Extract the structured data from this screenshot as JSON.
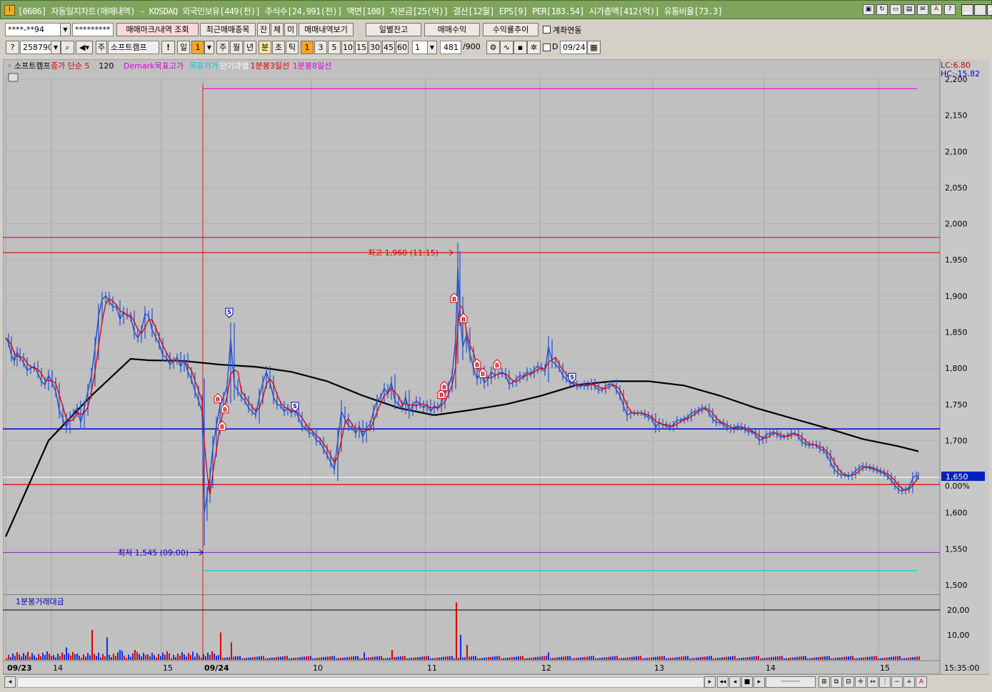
{
  "window": {
    "title": "[0606] 자동일지차트(매매내역) - KOSDAQ 외국인보유[449(천)] 주식수[24,991(천)] 액면[100] 자본금[25(억)] 결산[12월] EPS[9] PER[183.54] 시가총액[412(억)] 유통비율[73.3]",
    "app_icon": "I"
  },
  "toolbar1": {
    "account": "****-**94",
    "password": "*********",
    "btn_trade_mark": "매매마크/내역 조회",
    "btn_recent": "최근매매종목",
    "btn_jan": "잔",
    "btn_che": "체",
    "btn_mi": "미",
    "btn_trade_history": "매매내역보기",
    "btn_daily_balance": "일별잔고",
    "btn_trade_profit": "매매수익",
    "btn_return_trend": "수익률추이",
    "chk_account_link": "계좌연동"
  },
  "toolbar2": {
    "stock_code": "258790",
    "stock_type": "주",
    "stock_name": "소프트캠프",
    "excl": "!",
    "period_day": "일",
    "period_day_val": "1",
    "period_week": "주",
    "period_month": "월",
    "period_year": "년",
    "period_min": "분",
    "period_sec": "초",
    "period_tick": "틱",
    "min_options": [
      "1",
      "3",
      "5",
      "10",
      "15",
      "30",
      "45",
      "60"
    ],
    "min_value": "1",
    "count_value": "481",
    "count_total": "/900",
    "chk_d": "D",
    "date_value": "09/24"
  },
  "chart_data": {
    "type": "line",
    "legend": [
      {
        "label": "소프트캠프",
        "color": "#000000"
      },
      {
        "label": "종가 단순 5",
        "color": "#e00000"
      },
      {
        "label": "120",
        "color": "#000000"
      },
      {
        "label": "Demark목표고가",
        "color": "#e000e0"
      },
      {
        "label": "목표저가",
        "color": "#00d0d0"
      },
      {
        "label": "단기과열",
        "color": "#ffffff"
      },
      {
        "label": "1분봉3일선",
        "color": "#e00000"
      },
      {
        "label": "1분봉8일선",
        "color": "#e000e0"
      }
    ],
    "lc_label": "LC:6.80",
    "hc_label": "HC:-15.82",
    "ylim": [
      1480,
      2210
    ],
    "yticks": [
      "2,200",
      "2,150",
      "2,100",
      "2,050",
      "2,000",
      "1,950",
      "1,900",
      "1,850",
      "1,800",
      "1,750",
      "1,700",
      "1,650",
      "1,600",
      "1,550",
      "1,500"
    ],
    "x_date_labels": [
      "09/23",
      "14",
      "15",
      "09/24",
      "10",
      "11",
      "12",
      "13",
      "14",
      "15"
    ],
    "time_label": "15:35:00",
    "current_price": "1,650",
    "current_change": "0.00%",
    "high_annotation": "최고 1,960 (11:15)",
    "low_annotation": "최저 1,545 (09:00)",
    "high_value": 1960,
    "low_value": 1545,
    "hlines": [
      {
        "value": 2187,
        "color": "#e000e0",
        "name": "Demark목표고가"
      },
      {
        "value": 1981,
        "color": "#e00060",
        "name": "1분봉8일선"
      },
      {
        "value": 1960,
        "color": "#e00000",
        "name": "최고"
      },
      {
        "value": 1716,
        "color": "#0000d0",
        "name": "1분봉3일선"
      },
      {
        "value": 1649,
        "color": "#ffffff",
        "name": "단기과열"
      },
      {
        "value": 1639,
        "color": "#e00000",
        "name": "기준가"
      },
      {
        "value": 1545,
        "color": "#9030c0",
        "name": "최저"
      },
      {
        "value": 1520,
        "color": "#00d0d0",
        "name": "목표저가"
      }
    ],
    "price_series": [
      [
        0,
        1842
      ],
      [
        4,
        1835
      ],
      [
        8,
        1818
      ],
      [
        12,
        1810
      ],
      [
        16,
        1822
      ],
      [
        20,
        1815
      ],
      [
        25,
        1808
      ],
      [
        30,
        1797
      ],
      [
        35,
        1800
      ],
      [
        40,
        1803
      ],
      [
        45,
        1793
      ],
      [
        50,
        1782
      ],
      [
        55,
        1777
      ],
      [
        60,
        1790
      ],
      [
        65,
        1780
      ],
      [
        70,
        1768
      ],
      [
        75,
        1742
      ],
      [
        80,
        1730
      ],
      [
        85,
        1718
      ],
      [
        90,
        1732
      ],
      [
        95,
        1738
      ],
      [
        100,
        1745
      ],
      [
        105,
        1725
      ],
      [
        110,
        1745
      ],
      [
        115,
        1768
      ],
      [
        120,
        1790
      ],
      [
        125,
        1828
      ],
      [
        130,
        1872
      ],
      [
        135,
        1895
      ],
      [
        140,
        1900
      ],
      [
        145,
        1893
      ],
      [
        150,
        1885
      ],
      [
        155,
        1885
      ],
      [
        160,
        1868
      ],
      [
        165,
        1878
      ],
      [
        170,
        1873
      ],
      [
        175,
        1870
      ],
      [
        180,
        1850
      ],
      [
        185,
        1842
      ],
      [
        190,
        1852
      ],
      [
        195,
        1875
      ],
      [
        200,
        1873
      ],
      [
        205,
        1853
      ],
      [
        210,
        1843
      ],
      [
        215,
        1833
      ],
      [
        220,
        1818
      ],
      [
        225,
        1815
      ],
      [
        230,
        1805
      ],
      [
        235,
        1810
      ],
      [
        240,
        1815
      ],
      [
        245,
        1802
      ],
      [
        250,
        1812
      ],
      [
        255,
        1795
      ],
      [
        260,
        1785
      ],
      [
        265,
        1768
      ],
      [
        270,
        1755
      ],
      [
        275,
        1740
      ],
      [
        278,
        1600
      ],
      [
        282,
        1625
      ],
      [
        286,
        1650
      ],
      [
        290,
        1690
      ],
      [
        295,
        1720
      ],
      [
        300,
        1748
      ],
      [
        305,
        1760
      ],
      [
        310,
        1775
      ],
      [
        315,
        1840
      ],
      [
        320,
        1778
      ],
      [
        325,
        1768
      ],
      [
        330,
        1760
      ],
      [
        335,
        1755
      ],
      [
        340,
        1745
      ],
      [
        345,
        1740
      ],
      [
        350,
        1735
      ],
      [
        355,
        1760
      ],
      [
        360,
        1780
      ],
      [
        365,
        1795
      ],
      [
        370,
        1780
      ],
      [
        375,
        1760
      ],
      [
        380,
        1750
      ],
      [
        385,
        1748
      ],
      [
        390,
        1740
      ],
      [
        395,
        1745
      ],
      [
        400,
        1738
      ],
      [
        405,
        1742
      ],
      [
        410,
        1732
      ],
      [
        415,
        1720
      ],
      [
        420,
        1718
      ],
      [
        425,
        1710
      ],
      [
        430,
        1710
      ],
      [
        435,
        1700
      ],
      [
        440,
        1698
      ],
      [
        445,
        1688
      ],
      [
        450,
        1680
      ],
      [
        455,
        1670
      ],
      [
        460,
        1660
      ],
      [
        465,
        1700
      ],
      [
        470,
        1740
      ],
      [
        475,
        1730
      ],
      [
        480,
        1720
      ],
      [
        485,
        1718
      ],
      [
        490,
        1710
      ],
      [
        495,
        1720
      ],
      [
        500,
        1705
      ],
      [
        505,
        1718
      ],
      [
        510,
        1722
      ],
      [
        515,
        1740
      ],
      [
        520,
        1755
      ],
      [
        525,
        1760
      ],
      [
        530,
        1772
      ],
      [
        535,
        1765
      ],
      [
        540,
        1780
      ],
      [
        545,
        1755
      ],
      [
        550,
        1750
      ],
      [
        555,
        1745
      ],
      [
        560,
        1760
      ],
      [
        565,
        1740
      ],
      [
        570,
        1748
      ],
      [
        575,
        1755
      ],
      [
        580,
        1750
      ],
      [
        585,
        1745
      ],
      [
        590,
        1750
      ],
      [
        595,
        1740
      ],
      [
        600,
        1748
      ],
      [
        605,
        1745
      ],
      [
        610,
        1752
      ],
      [
        615,
        1765
      ],
      [
        620,
        1775
      ],
      [
        625,
        1790
      ],
      [
        630,
        1840
      ],
      [
        633,
        1940
      ],
      [
        636,
        1880
      ],
      [
        640,
        1830
      ],
      [
        645,
        1845
      ],
      [
        650,
        1820
      ],
      [
        655,
        1800
      ],
      [
        660,
        1785
      ],
      [
        665,
        1795
      ],
      [
        670,
        1780
      ],
      [
        675,
        1785
      ],
      [
        680,
        1795
      ],
      [
        685,
        1790
      ],
      [
        690,
        1792
      ],
      [
        695,
        1795
      ],
      [
        700,
        1790
      ],
      [
        705,
        1778
      ],
      [
        710,
        1780
      ],
      [
        715,
        1785
      ],
      [
        720,
        1790
      ],
      [
        725,
        1788
      ],
      [
        730,
        1795
      ],
      [
        735,
        1792
      ],
      [
        740,
        1798
      ],
      [
        745,
        1803
      ],
      [
        750,
        1800
      ],
      [
        755,
        1795
      ],
      [
        760,
        1830
      ],
      [
        765,
        1810
      ],
      [
        770,
        1805
      ],
      [
        775,
        1800
      ],
      [
        780,
        1790
      ],
      [
        785,
        1785
      ],
      [
        790,
        1780
      ],
      [
        795,
        1778
      ],
      [
        800,
        1775
      ],
      [
        805,
        1775
      ],
      [
        810,
        1778
      ],
      [
        815,
        1775
      ],
      [
        820,
        1780
      ],
      [
        825,
        1775
      ],
      [
        830,
        1770
      ],
      [
        835,
        1770
      ],
      [
        840,
        1775
      ],
      [
        845,
        1778
      ],
      [
        850,
        1778
      ],
      [
        855,
        1770
      ],
      [
        860,
        1762
      ],
      [
        865,
        1748
      ],
      [
        870,
        1735
      ],
      [
        875,
        1738
      ],
      [
        880,
        1738
      ],
      [
        885,
        1738
      ],
      [
        890,
        1738
      ],
      [
        895,
        1735
      ],
      [
        900,
        1732
      ],
      [
        905,
        1730
      ],
      [
        910,
        1718
      ],
      [
        915,
        1725
      ],
      [
        920,
        1722
      ],
      [
        925,
        1720
      ],
      [
        930,
        1718
      ],
      [
        935,
        1722
      ],
      [
        940,
        1728
      ],
      [
        945,
        1728
      ],
      [
        950,
        1730
      ],
      [
        955,
        1732
      ],
      [
        960,
        1738
      ],
      [
        965,
        1740
      ],
      [
        970,
        1742
      ],
      [
        975,
        1745
      ],
      [
        980,
        1745
      ],
      [
        985,
        1738
      ],
      [
        990,
        1730
      ],
      [
        995,
        1725
      ],
      [
        1000,
        1725
      ],
      [
        1005,
        1722
      ],
      [
        1010,
        1718
      ],
      [
        1015,
        1715
      ],
      [
        1020,
        1718
      ],
      [
        1025,
        1720
      ],
      [
        1030,
        1718
      ],
      [
        1035,
        1715
      ],
      [
        1040,
        1712
      ],
      [
        1045,
        1712
      ],
      [
        1050,
        1708
      ],
      [
        1055,
        1700
      ],
      [
        1060,
        1702
      ],
      [
        1065,
        1708
      ],
      [
        1070,
        1710
      ],
      [
        1075,
        1712
      ],
      [
        1080,
        1708
      ],
      [
        1085,
        1705
      ],
      [
        1090,
        1705
      ],
      [
        1095,
        1707
      ],
      [
        1100,
        1710
      ],
      [
        1105,
        1710
      ],
      [
        1110,
        1705
      ],
      [
        1115,
        1698
      ],
      [
        1120,
        1695
      ],
      [
        1125,
        1693
      ],
      [
        1130,
        1695
      ],
      [
        1135,
        1693
      ],
      [
        1140,
        1688
      ],
      [
        1145,
        1686
      ],
      [
        1150,
        1680
      ],
      [
        1155,
        1670
      ],
      [
        1160,
        1660
      ],
      [
        1165,
        1655
      ],
      [
        1170,
        1652
      ],
      [
        1175,
        1652
      ],
      [
        1180,
        1650
      ],
      [
        1185,
        1653
      ],
      [
        1190,
        1658
      ],
      [
        1195,
        1662
      ],
      [
        1200,
        1665
      ],
      [
        1205,
        1663
      ],
      [
        1210,
        1662
      ],
      [
        1215,
        1660
      ],
      [
        1220,
        1658
      ],
      [
        1225,
        1656
      ],
      [
        1230,
        1654
      ],
      [
        1235,
        1650
      ],
      [
        1240,
        1645
      ],
      [
        1245,
        1638
      ],
      [
        1250,
        1632
      ],
      [
        1255,
        1630
      ],
      [
        1260,
        1632
      ],
      [
        1265,
        1635
      ],
      [
        1270,
        1648
      ],
      [
        1275,
        1652
      ],
      [
        1278,
        1650
      ]
    ],
    "ma120_series": [
      [
        0,
        1567
      ],
      [
        60,
        1700
      ],
      [
        120,
        1762
      ],
      [
        175,
        1813
      ],
      [
        200,
        1811
      ],
      [
        250,
        1810
      ],
      [
        300,
        1805
      ],
      [
        350,
        1802
      ],
      [
        400,
        1795
      ],
      [
        450,
        1782
      ],
      [
        500,
        1762
      ],
      [
        550,
        1745
      ],
      [
        600,
        1735
      ],
      [
        650,
        1742
      ],
      [
        700,
        1750
      ],
      [
        750,
        1762
      ],
      [
        800,
        1777
      ],
      [
        850,
        1782
      ],
      [
        900,
        1782
      ],
      [
        950,
        1776
      ],
      [
        1000,
        1762
      ],
      [
        1050,
        1745
      ],
      [
        1100,
        1731
      ],
      [
        1150,
        1717
      ],
      [
        1200,
        1702
      ],
      [
        1250,
        1692
      ],
      [
        1278,
        1685
      ]
    ],
    "buy_marks": [
      [
        297,
        1758
      ],
      [
        307,
        1744
      ],
      [
        303,
        1720
      ],
      [
        628,
        1897
      ],
      [
        641,
        1869
      ],
      [
        660,
        1806
      ],
      [
        668,
        1793
      ],
      [
        688,
        1805
      ],
      [
        610,
        1764
      ],
      [
        614,
        1775
      ]
    ],
    "sell_marks": [
      [
        313,
        1877
      ],
      [
        405,
        1747
      ],
      [
        793,
        1787
      ]
    ],
    "volume_title": "1분봉거래대금",
    "volume_yticks": [
      "20,00",
      "10,00"
    ],
    "volume_ylim": [
      0,
      24
    ],
    "volume_spikes": [
      [
        120,
        12
      ],
      [
        140,
        9
      ],
      [
        300,
        11
      ],
      [
        315,
        7
      ],
      [
        631,
        23
      ],
      [
        635,
        10
      ],
      [
        645,
        6
      ],
      [
        85,
        5
      ],
      [
        160,
        4
      ],
      [
        180,
        4
      ],
      [
        500,
        3
      ],
      [
        540,
        4
      ],
      [
        760,
        3
      ]
    ]
  },
  "scrollbar": {
    "arrows": [
      "◂",
      "▸",
      "◂◂",
      "◂",
      "■",
      "▸",
      "▸▸"
    ],
    "zoom_out": "−",
    "zoom_in": "+",
    "font_icon": "A"
  }
}
